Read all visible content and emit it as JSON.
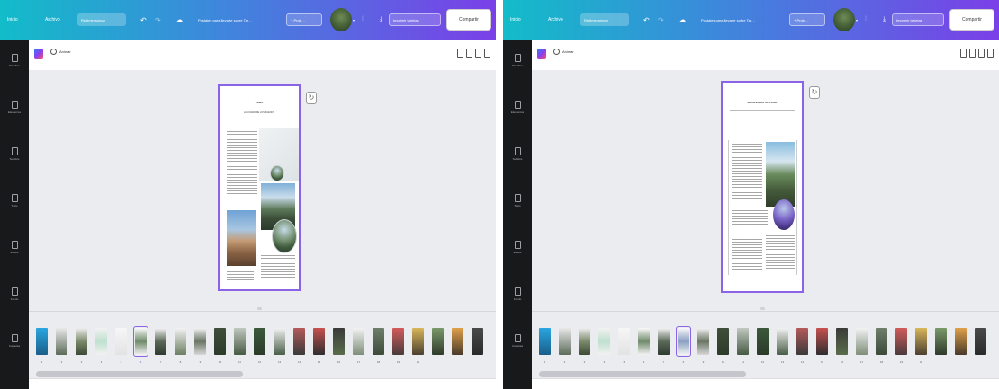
{
  "panels": [
    {
      "id": "left",
      "topbar": {
        "home": "Inicio",
        "file": "Archivo",
        "resize": "Redimensionar",
        "doc_title": "Postales para llevarte sobre Tar…",
        "print": "+ Prob…",
        "print_btn": "Imprimir tarjetas",
        "share": "Compartir"
      },
      "toolbar": {
        "animate": "Animar"
      },
      "sidebar": [
        {
          "label": "Plantillas",
          "icon": "templates-icon"
        },
        {
          "label": "Elementos",
          "icon": "elements-icon"
        },
        {
          "label": "Subidos",
          "icon": "uploads-icon"
        },
        {
          "label": "Texto",
          "icon": "text-icon"
        },
        {
          "label": "Estilos",
          "icon": "styles-icon"
        },
        {
          "label": "Fondo",
          "icon": "background-icon"
        },
        {
          "label": "Carpetas",
          "icon": "folders-icon"
        }
      ],
      "page": {
        "title": "LEMA",
        "subtitle": "LA CIUDAD DE LOS SUEÑOS"
      },
      "thumbnails": [
        "1",
        "2",
        "3",
        "4",
        "5",
        "6",
        "7",
        "8",
        "9",
        "10",
        "11",
        "12",
        "13",
        "14",
        "15",
        "16",
        "17",
        "18",
        "19",
        "20"
      ],
      "active_thumb": 5
    },
    {
      "id": "right",
      "topbar": {
        "home": "Inicio",
        "file": "Archivo",
        "resize": "Redimensionar",
        "doc_title": "Postales para llevarte sobre Tar…",
        "print": "+ Prob…",
        "print_btn": "Imprimir tarjetas",
        "share": "Compartir"
      },
      "toolbar": {
        "animate": "Animar"
      },
      "sidebar": [
        {
          "label": "Plantillas",
          "icon": "templates-icon"
        },
        {
          "label": "Elementos",
          "icon": "elements-icon"
        },
        {
          "label": "Subidos",
          "icon": "uploads-icon"
        },
        {
          "label": "Texto",
          "icon": "text-icon"
        },
        {
          "label": "Estilos",
          "icon": "styles-icon"
        },
        {
          "label": "Fondo",
          "icon": "background-icon"
        },
        {
          "label": "Carpetas",
          "icon": "folders-icon"
        }
      ],
      "page": {
        "title": "BIENVENIDO AL VIAJE"
      },
      "thumbnails": [
        "1",
        "2",
        "3",
        "4",
        "5",
        "6",
        "7",
        "8",
        "9",
        "10",
        "11",
        "12",
        "13",
        "14",
        "15",
        "16",
        "17",
        "18",
        "19",
        "20"
      ],
      "active_thumb": 6
    }
  ],
  "colors": {
    "accent": "#8a63e6",
    "sidebar": "#18191b",
    "topbar_start": "#12bcc9",
    "topbar_end": "#7b3fe8",
    "canvas": "#ebecf0"
  }
}
